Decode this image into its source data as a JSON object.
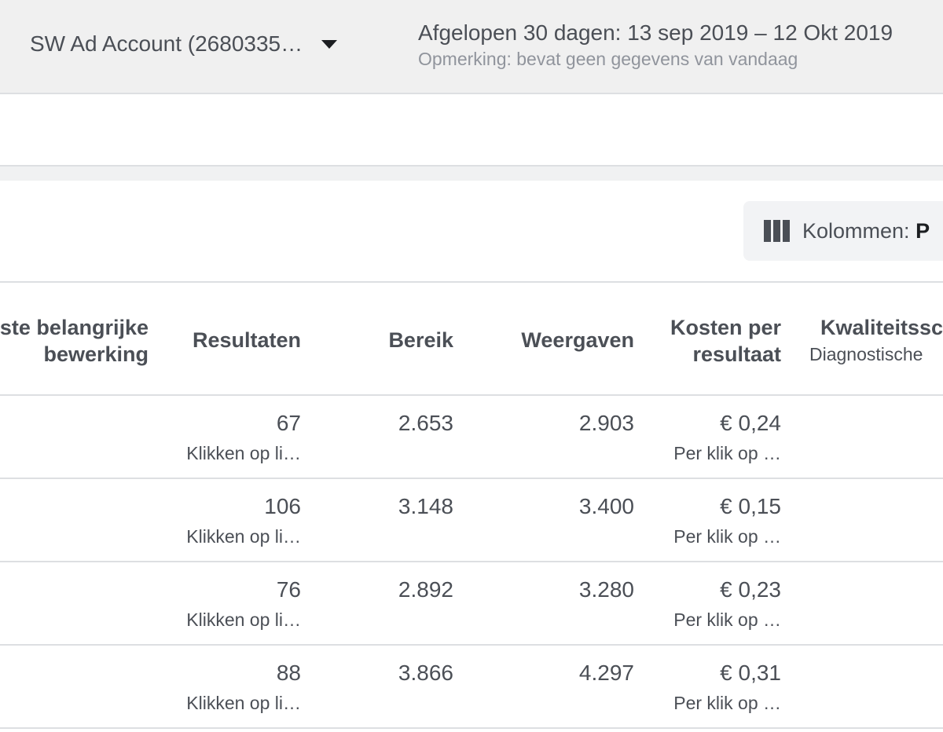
{
  "topbar": {
    "account_name": "SW Ad Account (2680335…",
    "date_range": "Afgelopen 30 dagen: 13 sep 2019 – 12 Okt 2019",
    "date_note": "Opmerking: bevat geen gegevens van vandaag"
  },
  "toolbar": {
    "columns_label": "Kolommen:",
    "columns_value": "P"
  },
  "table": {
    "headers": {
      "edit_line1": "ste belangrijke",
      "edit_line2": "bewerking",
      "results": "Resultaten",
      "reach": "Bereik",
      "impressions": "Weergaven",
      "cost_line1": "Kosten per",
      "cost_line2": "resultaat",
      "quality_line1": "Kwaliteitssc",
      "quality_line2": "Diagnostische"
    },
    "rows": [
      {
        "results": "67",
        "results_type": "Klikken op li…",
        "reach": "2.653",
        "impressions": "2.903",
        "cost": "€ 0,24",
        "cost_type": "Per klik op …"
      },
      {
        "results": "106",
        "results_type": "Klikken op li…",
        "reach": "3.148",
        "impressions": "3.400",
        "cost": "€ 0,15",
        "cost_type": "Per klik op …"
      },
      {
        "results": "76",
        "results_type": "Klikken op li…",
        "reach": "2.892",
        "impressions": "3.280",
        "cost": "€ 0,23",
        "cost_type": "Per klik op …"
      },
      {
        "results": "88",
        "results_type": "Klikken op li…",
        "reach": "3.866",
        "impressions": "4.297",
        "cost": "€ 0,31",
        "cost_type": "Per klik op …"
      }
    ]
  }
}
